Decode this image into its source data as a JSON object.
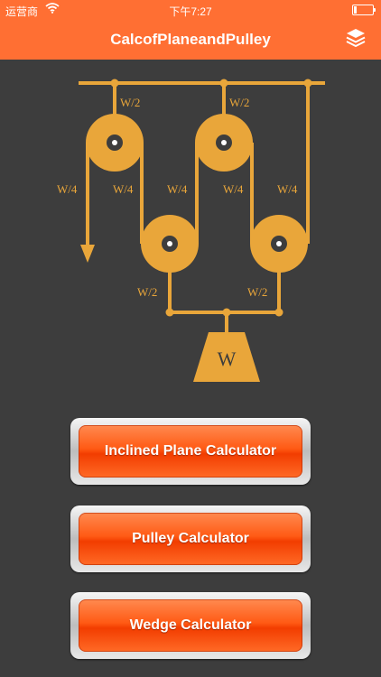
{
  "status": {
    "carrier": "运营商",
    "time": "下午7:27"
  },
  "header": {
    "title": "CalcofPlaneandPulley"
  },
  "diagram": {
    "labels": {
      "top_left": "W/2",
      "top_right": "W/2",
      "seg1": "W/4",
      "seg2": "W/4",
      "seg3": "W/4",
      "seg4": "W/4",
      "seg5": "W/4",
      "bottom_left": "W/2",
      "bottom_right": "W/2",
      "weight": "W"
    },
    "color": "#e9a63a"
  },
  "buttons": {
    "inclined": "Inclined Plane Calculator",
    "pulley": "Pulley Calculator",
    "wedge": "Wedge Calculator"
  },
  "colors": {
    "accent": "#ff6f33",
    "background": "#3d3d3d"
  }
}
